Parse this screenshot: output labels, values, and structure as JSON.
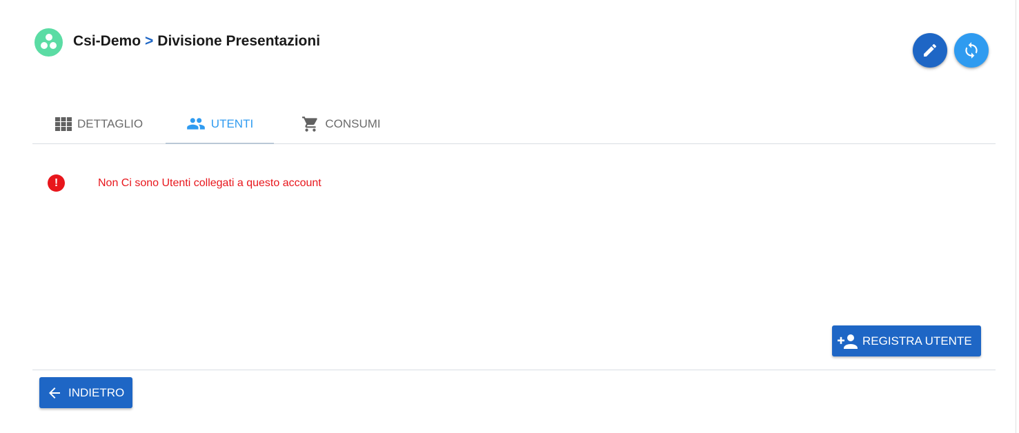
{
  "header": {
    "logo_icon": "organization-logo-icon",
    "breadcrumb": {
      "parent": "Csi-Demo",
      "separator": ">",
      "current": "Divisione Presentazioni"
    }
  },
  "actions": {
    "edit_icon": "pencil-icon",
    "refresh_icon": "refresh-icon"
  },
  "tabs": [
    {
      "label": "DETTAGLIO",
      "icon": "grid-icon",
      "active": false
    },
    {
      "label": "UTENTI",
      "icon": "users-icon",
      "active": true
    },
    {
      "label": "CONSUMI",
      "icon": "cart-icon",
      "active": false
    }
  ],
  "message": {
    "icon": "alert-circle-icon",
    "icon_glyph": "!",
    "text": "Non Ci sono Utenti collegati a questo account"
  },
  "buttons": {
    "register_label": "REGISTRA UTENTE",
    "register_icon": "add-user-icon",
    "back_label": "INDIETRO",
    "back_icon": "arrow-left-icon"
  },
  "colors": {
    "primary": "#1e66c5",
    "accent": "#2f9bf0",
    "error": "#e8161c",
    "logo": "#5bdca4"
  }
}
